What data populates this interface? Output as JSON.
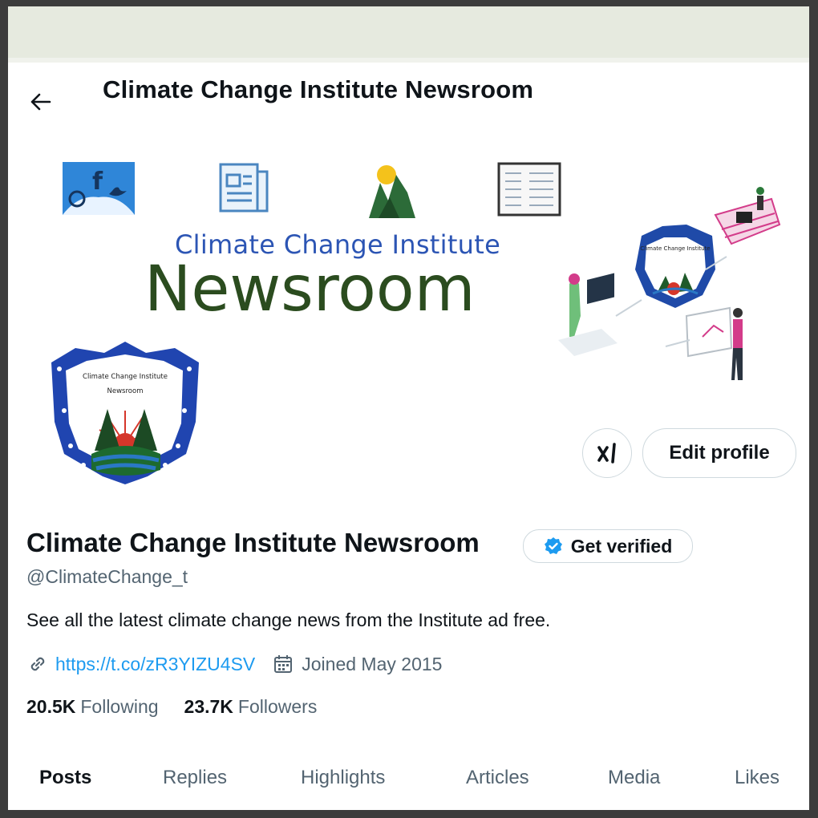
{
  "header": {
    "title": "Climate Change Institute Newsroom"
  },
  "banner": {
    "line1": "Climate Change Institute",
    "line2": "Newsroom"
  },
  "avatar": {
    "line1": "Climate Change Institute",
    "line2": "Newsroom"
  },
  "profile": {
    "name": "Climate Change Institute Newsroom",
    "verified_label": "Get verified",
    "handle": "@ClimateChange_t",
    "bio": "See all the latest climate change news from the Institute ad free.",
    "link": "https://t.co/zR3YIZU4SV",
    "joined": "Joined May 2015",
    "following_count": "20.5K",
    "following_label": "Following",
    "followers_count": "23.7K",
    "followers_label": "Followers"
  },
  "actions": {
    "grok_label": "ẋΙ",
    "edit_label": "Edit profile"
  },
  "tabs": [
    {
      "label": "Posts"
    },
    {
      "label": "Replies"
    },
    {
      "label": "Highlights"
    },
    {
      "label": "Articles"
    },
    {
      "label": "Media"
    },
    {
      "label": "Likes"
    }
  ],
  "colors": {
    "accent": "#1d9bf0",
    "banner_blue": "#2c55b4",
    "banner_green": "#2b4c1f"
  }
}
